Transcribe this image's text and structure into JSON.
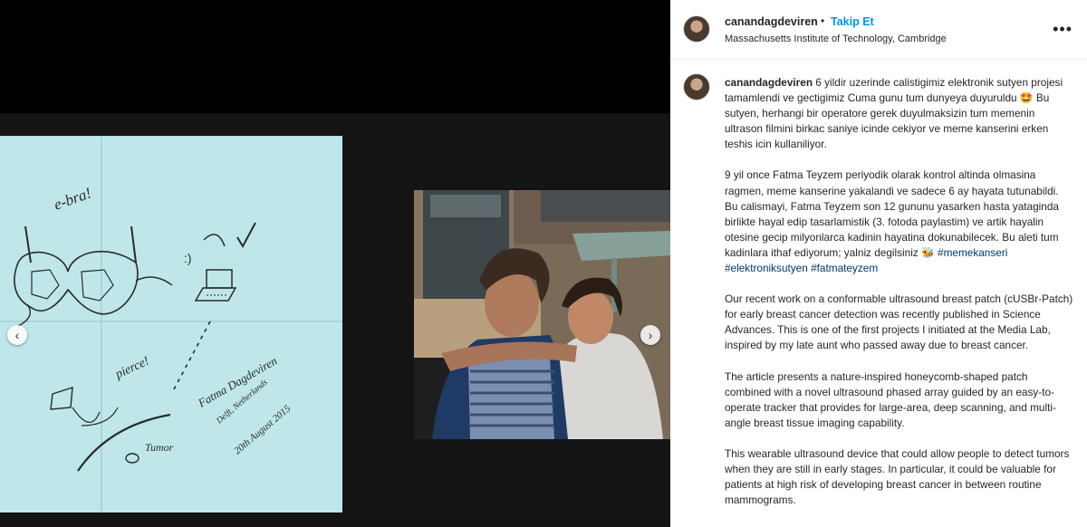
{
  "post": {
    "username": "canandagdeviren",
    "separator": "•",
    "follow_label": "Takip Et",
    "location": "Massachusetts Institute of Technology, Cambridge",
    "more_icon": "more-horizontal-icon"
  },
  "carousel": {
    "prev_icon": "chevron-left-icon",
    "next_icon": "chevron-right-icon",
    "prev_glyph": "‹",
    "next_glyph": "›"
  },
  "sketch": {
    "label_ebra": "e-bra!",
    "label_pierce": "pierce!",
    "label_tumor": "Tumor",
    "signature_name": "Fatma Dagdeviren",
    "signature_place": "Delft, Netherlands",
    "signature_date": "20th August 2015"
  },
  "caption": {
    "username": "canandagdeviren",
    "para1_text": " 6 yildir uzerinde calistigimiz elektronik sutyen projesi tamamlendi ve gectigimiz Cuma gunu tum dunyeya duyuruldu 🤩 Bu sutyen, herhangi bir operatore gerek duyulmaksizin tum memenin ultrason filmini birkac saniye icinde cekiyor ve meme kanserini erken teshis icin kullaniliyor.",
    "para2_text": "9 yil once Fatma Teyzem periyodik olarak kontrol altinda olmasina ragmen, meme kanserine yakalandi ve sadece 6 ay hayata tutunabildi. Bu calismayi, Fatma Teyzem son 12 gununu yasarken hasta yataginda birlikte hayal edip tasarlamistik (3. fotoda paylastim) ve artik hayalin otesine gecip milyonlarca kadinin hayatina dokunabilecek. Bu aleti tum kadinlara ithaf ediyorum; yalniz degilsiniz 🐝 ",
    "hashtag1": "#memekanseri",
    "hashtag2": "#elektroniksutyen",
    "hashtag3": "#fatmateyzem",
    "para3": "Our recent work on a conformable ultrasound breast patch (cUSBr-Patch) for early breast cancer detection was recently published in Science Advances. This is one of the first projects I initiated at the Media Lab, inspired by my late aunt who passed away due to breast cancer.",
    "para4": "The article presents a nature-inspired honeycomb-shaped patch combined with a novel ultrasound phased array guided by an easy-to-operate tracker that provides for large-area, deep scanning, and multi-angle breast tissue imaging capability.",
    "para5": "This wearable ultrasound device that could allow people to detect tumors when they are still in early stages. In particular, it could be valuable for patients at high risk of developing breast cancer in between routine mammograms."
  }
}
